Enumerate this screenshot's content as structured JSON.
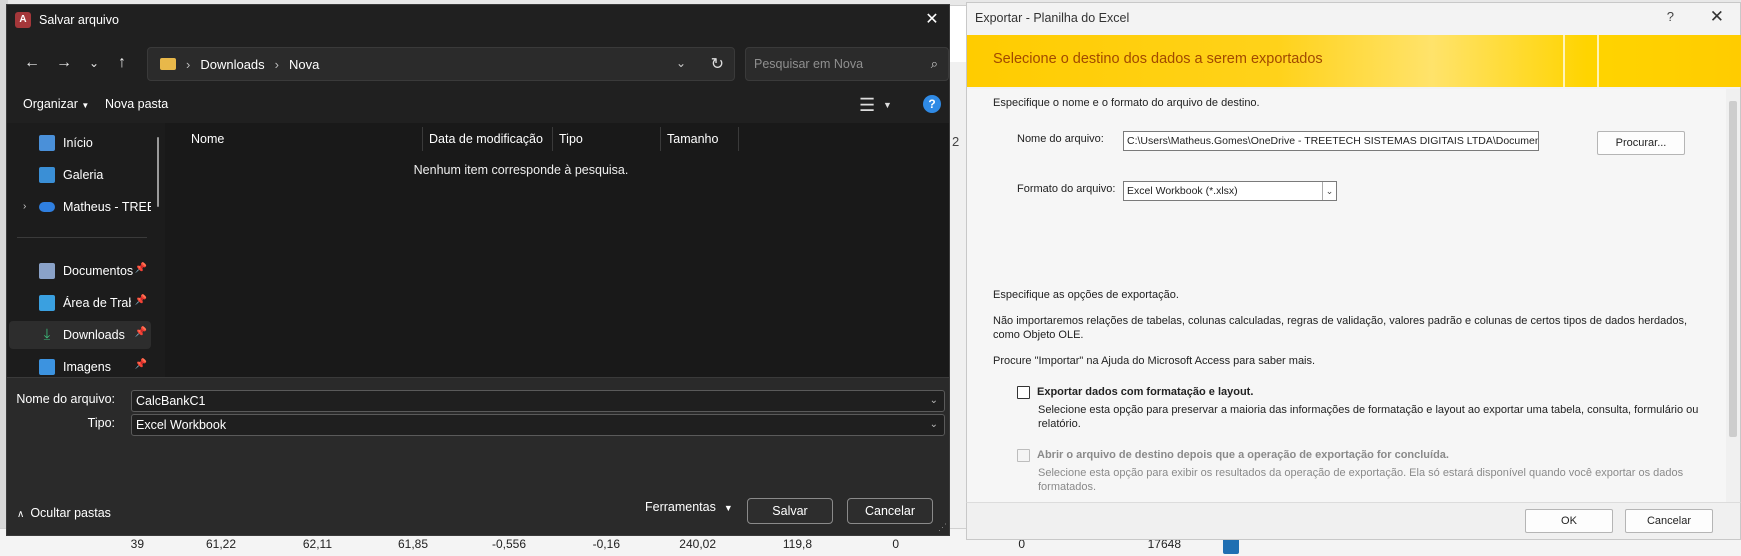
{
  "background": {
    "row": [
      "39",
      "61,22",
      "62,11",
      "61,85",
      "-0,556",
      "-0,16",
      "240,02",
      "119,8",
      "0",
      "0",
      "17648"
    ],
    "side_number": "2"
  },
  "save_dialog": {
    "title": "Salvar arquivo",
    "breadcrumb": [
      "Downloads",
      "Nova"
    ],
    "search_placeholder": "Pesquisar em Nova",
    "organize_label": "Organizar",
    "new_folder_label": "Nova pasta",
    "sidebar": [
      {
        "label": "Início",
        "icon": "home-icon",
        "color": "#4a90d9"
      },
      {
        "label": "Galeria",
        "icon": "gallery-icon",
        "color": "#3a8fd6"
      },
      {
        "label": "Matheus - TREETECH",
        "icon": "onedrive-icon",
        "color": "#2f7fe0"
      },
      {
        "label": "Documentos",
        "icon": "documents-icon",
        "color": "#8aa2c8",
        "pinned": true
      },
      {
        "label": "Área de Trabalho",
        "icon": "desktop-icon",
        "color": "#3aa0e0",
        "pinned": true
      },
      {
        "label": "Downloads",
        "icon": "downloads-icon",
        "color": "#3dbb7a",
        "pinned": true,
        "selected": true
      },
      {
        "label": "Imagens",
        "icon": "pictures-icon",
        "color": "#3c93e0",
        "pinned": true
      }
    ],
    "columns": [
      "Nome",
      "Data de modificação",
      "Tipo",
      "Tamanho"
    ],
    "empty_message": "Nenhum item corresponde à pesquisa.",
    "filename_label": "Nome do arquivo:",
    "filename_value": "CalcBankC1",
    "type_label": "Tipo:",
    "type_value": "Excel Workbook",
    "tools_label": "Ferramentas",
    "save_label": "Salvar",
    "cancel_label": "Cancelar",
    "hide_folders_label": "Ocultar pastas"
  },
  "export_dialog": {
    "title": "Exportar - Planilha do Excel",
    "help": "?",
    "banner": "Selecione o destino dos dados a serem exportados",
    "specify_name": "Especifique o nome e o formato do arquivo de destino.",
    "filename_label": "Nome do arquivo:",
    "filename_value": "C:\\Users\\Matheus.Gomes\\OneDrive - TREETECH SISTEMAS DIGITAIS LTDA\\Documentos\\CalcBan",
    "browse_label": "Procurar...",
    "format_label": "Formato do arquivo:",
    "format_value": "Excel Workbook (*.xlsx)",
    "specify_options": "Especifique as opções de exportação.",
    "note_line1": "Não importaremos relações de tabelas, colunas calculadas, regras de validação, valores padrão e colunas de certos tipos de dados herdados,",
    "note_line2": "como Objeto OLE.",
    "help_hint": "Procure \"Importar\" na Ajuda do Microsoft Access para saber mais.",
    "opt1_label": "Exportar dados com formatação e layout.",
    "opt1_desc1": "Selecione esta opção para preservar a maioria das informações de formatação e layout ao exportar uma tabela, consulta, formulário ou",
    "opt1_desc2": "relatório.",
    "opt2_label": "Abrir o arquivo de destino depois que a operação de exportação for concluída.",
    "opt2_desc1": "Selecione esta opção para exibir os resultados da operação de exportação. Ela só estará disponível quando você exportar os dados",
    "opt2_desc2": "formatados.",
    "ok_label": "OK",
    "cancel_label": "Cancelar"
  }
}
